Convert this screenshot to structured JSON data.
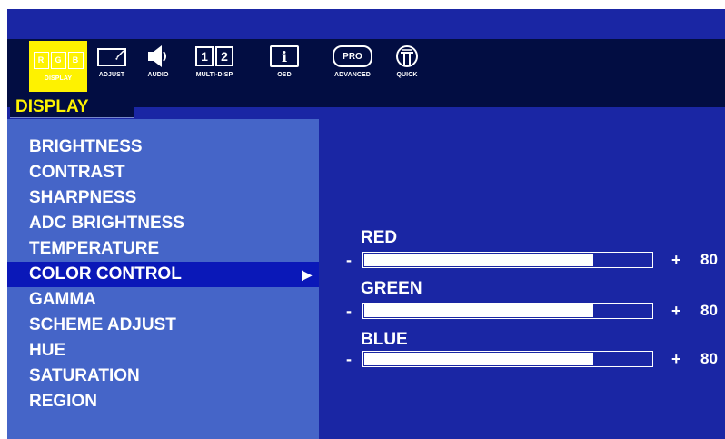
{
  "tabs": [
    {
      "id": "display",
      "label": "DISPLAY",
      "icon": "rgb-display-icon",
      "active": true
    },
    {
      "id": "adjust",
      "label": "ADJUST",
      "icon": "monitor-adjust-icon"
    },
    {
      "id": "audio",
      "label": "AUDIO",
      "icon": "speaker-icon"
    },
    {
      "id": "multi",
      "label": "MULTI-DISP",
      "icon": "multi-display-icon"
    },
    {
      "id": "osd",
      "label": "OSD",
      "icon": "info-icon"
    },
    {
      "id": "advanced",
      "label": "ADVANCED",
      "icon": "pro-icon",
      "badge": "PRO"
    },
    {
      "id": "quick",
      "label": "QUICK",
      "icon": "quick-icon"
    }
  ],
  "rgb_letters": [
    "R",
    "G",
    "B"
  ],
  "multi_numbers": [
    "1",
    "2"
  ],
  "osd_glyph": "i",
  "section_title": "DISPLAY",
  "menu": {
    "items": [
      "BRIGHTNESS",
      "CONTRAST",
      "SHARPNESS",
      "ADC BRIGHTNESS",
      "TEMPERATURE",
      "COLOR CONTROL",
      "GAMMA",
      "SCHEME ADJUST",
      "HUE",
      "SATURATION",
      "REGION"
    ],
    "selected_index": 5,
    "selected_arrow": "▶"
  },
  "color_control": {
    "minus": "-",
    "plus": "+",
    "channels": [
      {
        "label": "RED",
        "value": "80",
        "fill_fraction": 0.8
      },
      {
        "label": "GREEN",
        "value": "80",
        "fill_fraction": 0.8
      },
      {
        "label": "BLUE",
        "value": "80",
        "fill_fraction": 0.8
      }
    ]
  },
  "colors": {
    "background": "#1a26a4",
    "menu_panel": "#4565c8",
    "selected_row": "#0a18b8",
    "active_tab": "#fef200",
    "title_text": "#fef200"
  }
}
